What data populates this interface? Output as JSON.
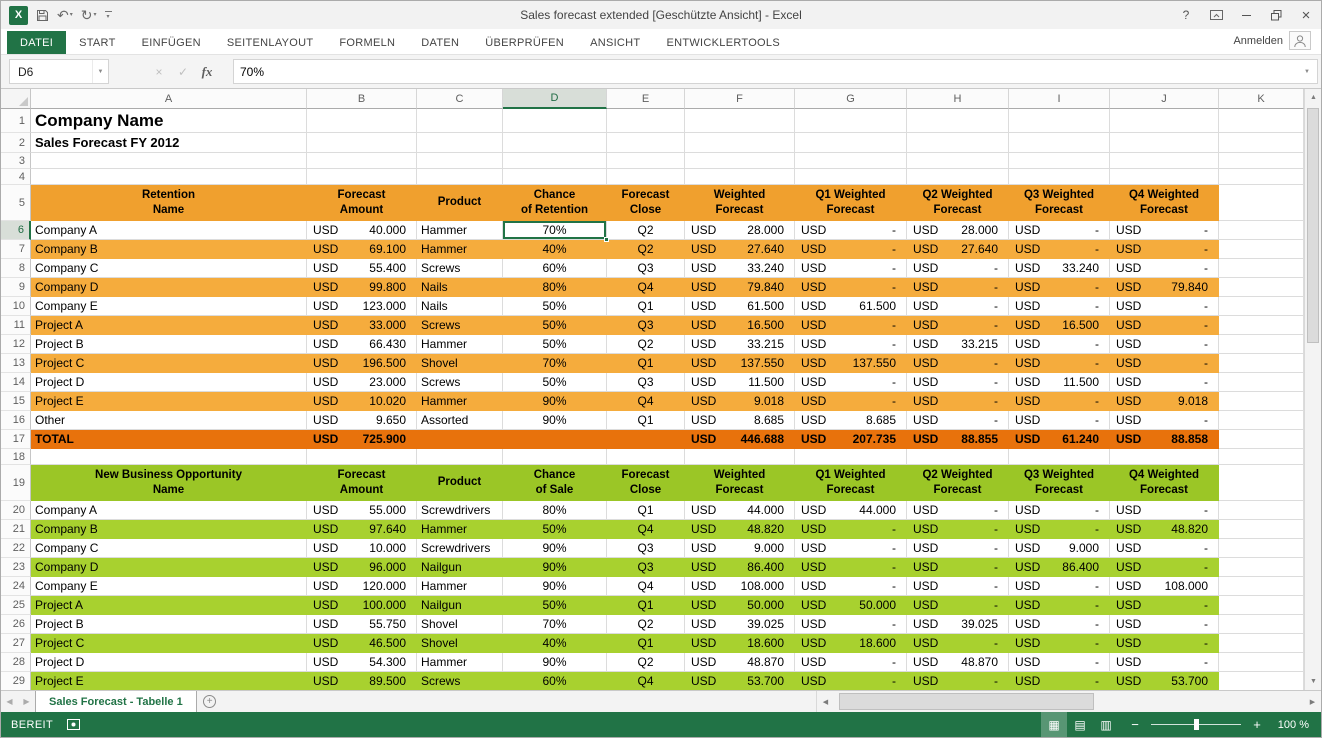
{
  "titlebar": {
    "title": "Sales forecast extended  [Geschützte Ansicht] - Excel",
    "logo_glyph": "X",
    "help_glyph": "?"
  },
  "ribbon": {
    "tabs": [
      {
        "label": "DATEI",
        "active": true
      },
      {
        "label": "START"
      },
      {
        "label": "EINFÜGEN"
      },
      {
        "label": "SEITENLAYOUT"
      },
      {
        "label": "FORMELN"
      },
      {
        "label": "DATEN"
      },
      {
        "label": "ÜBERPRÜFEN"
      },
      {
        "label": "ANSICHT"
      },
      {
        "label": "ENTWICKLERTOOLS"
      }
    ],
    "account_label": "Anmelden"
  },
  "formula_bar": {
    "name_box": "D6",
    "cancel_glyph": "×",
    "enter_glyph": "✓",
    "fx_glyph": "fx",
    "value": "70%"
  },
  "grid": {
    "columns": [
      "A",
      "B",
      "C",
      "D",
      "E",
      "F",
      "G",
      "H",
      "I",
      "J",
      "K"
    ],
    "selected": {
      "cell": "D6",
      "column": "D",
      "row": 6
    },
    "currency": "USD",
    "title": "Company Name",
    "subtitle": "Sales Forecast FY 2012",
    "tables": [
      {
        "accent": "orange",
        "header_row": 5,
        "headers": [
          "Retention\nName",
          "Forecast\nAmount",
          "Product",
          "Chance\nof Retention",
          "Forecast\nClose",
          "Weighted\nForecast",
          "Q1 Weighted\nForecast",
          "Q2 Weighted\nForecast",
          "Q3 Weighted\nForecast",
          "Q4 Weighted\nForecast"
        ],
        "rows": [
          {
            "row": 6,
            "name": "Company A",
            "amount": "40.000",
            "product": "Hammer",
            "chance": "70%",
            "close": "Q2",
            "weighted": "28.000",
            "q1": "-",
            "q2": "28.000",
            "q3": "-",
            "q4": "-",
            "striped": false
          },
          {
            "row": 7,
            "name": "Company B",
            "amount": "69.100",
            "product": "Hammer",
            "chance": "40%",
            "close": "Q2",
            "weighted": "27.640",
            "q1": "-",
            "q2": "27.640",
            "q3": "-",
            "q4": "-",
            "striped": true
          },
          {
            "row": 8,
            "name": "Company C",
            "amount": "55.400",
            "product": "Screws",
            "chance": "60%",
            "close": "Q3",
            "weighted": "33.240",
            "q1": "-",
            "q2": "-",
            "q3": "33.240",
            "q4": "-",
            "striped": false
          },
          {
            "row": 9,
            "name": "Company D",
            "amount": "99.800",
            "product": "Nails",
            "chance": "80%",
            "close": "Q4",
            "weighted": "79.840",
            "q1": "-",
            "q2": "-",
            "q3": "-",
            "q4": "79.840",
            "striped": true
          },
          {
            "row": 10,
            "name": "Company E",
            "amount": "123.000",
            "product": "Nails",
            "chance": "50%",
            "close": "Q1",
            "weighted": "61.500",
            "q1": "61.500",
            "q2": "-",
            "q3": "-",
            "q4": "-",
            "striped": false
          },
          {
            "row": 11,
            "name": "Project A",
            "amount": "33.000",
            "product": "Screws",
            "chance": "50%",
            "close": "Q3",
            "weighted": "16.500",
            "q1": "-",
            "q2": "-",
            "q3": "16.500",
            "q4": "-",
            "striped": true
          },
          {
            "row": 12,
            "name": "Project B",
            "amount": "66.430",
            "product": "Hammer",
            "chance": "50%",
            "close": "Q2",
            "weighted": "33.215",
            "q1": "-",
            "q2": "33.215",
            "q3": "-",
            "q4": "-",
            "striped": false
          },
          {
            "row": 13,
            "name": "Project C",
            "amount": "196.500",
            "product": "Shovel",
            "chance": "70%",
            "close": "Q1",
            "weighted": "137.550",
            "q1": "137.550",
            "q2": "-",
            "q3": "-",
            "q4": "-",
            "striped": true
          },
          {
            "row": 14,
            "name": "Project D",
            "amount": "23.000",
            "product": "Screws",
            "chance": "50%",
            "close": "Q3",
            "weighted": "11.500",
            "q1": "-",
            "q2": "-",
            "q3": "11.500",
            "q4": "-",
            "striped": false
          },
          {
            "row": 15,
            "name": "Project E",
            "amount": "10.020",
            "product": "Hammer",
            "chance": "90%",
            "close": "Q4",
            "weighted": "9.018",
            "q1": "-",
            "q2": "-",
            "q3": "-",
            "q4": "9.018",
            "striped": true
          },
          {
            "row": 16,
            "name": "Other",
            "amount": "9.650",
            "product": "Assorted",
            "chance": "90%",
            "close": "Q1",
            "weighted": "8.685",
            "q1": "8.685",
            "q2": "-",
            "q3": "-",
            "q4": "-",
            "striped": false
          }
        ],
        "total": {
          "row": 17,
          "label": "TOTAL",
          "amount": "725.900",
          "weighted": "446.688",
          "q1": "207.735",
          "q2": "88.855",
          "q3": "61.240",
          "q4": "88.858"
        },
        "empty_row_after": 18
      },
      {
        "accent": "green",
        "header_row": 19,
        "headers": [
          "New Business Opportunity\nName",
          "Forecast\nAmount",
          "Product",
          "Chance\nof Sale",
          "Forecast\nClose",
          "Weighted\nForecast",
          "Q1 Weighted\nForecast",
          "Q2 Weighted\nForecast",
          "Q3 Weighted\nForecast",
          "Q4 Weighted\nForecast"
        ],
        "rows": [
          {
            "row": 20,
            "name": "Company A",
            "amount": "55.000",
            "product": "Screwdrivers",
            "chance": "80%",
            "close": "Q1",
            "weighted": "44.000",
            "q1": "44.000",
            "q2": "-",
            "q3": "-",
            "q4": "-",
            "striped": false
          },
          {
            "row": 21,
            "name": "Company B",
            "amount": "97.640",
            "product": "Hammer",
            "chance": "50%",
            "close": "Q4",
            "weighted": "48.820",
            "q1": "-",
            "q2": "-",
            "q3": "-",
            "q4": "48.820",
            "striped": true
          },
          {
            "row": 22,
            "name": "Company C",
            "amount": "10.000",
            "product": "Screwdrivers",
            "chance": "90%",
            "close": "Q3",
            "weighted": "9.000",
            "q1": "-",
            "q2": "-",
            "q3": "9.000",
            "q4": "-",
            "striped": false
          },
          {
            "row": 23,
            "name": "Company D",
            "amount": "96.000",
            "product": "Nailgun",
            "chance": "90%",
            "close": "Q3",
            "weighted": "86.400",
            "q1": "-",
            "q2": "-",
            "q3": "86.400",
            "q4": "-",
            "striped": true
          },
          {
            "row": 24,
            "name": "Company E",
            "amount": "120.000",
            "product": "Hammer",
            "chance": "90%",
            "close": "Q4",
            "weighted": "108.000",
            "q1": "-",
            "q2": "-",
            "q3": "-",
            "q4": "108.000",
            "striped": false
          },
          {
            "row": 25,
            "name": "Project A",
            "amount": "100.000",
            "product": "Nailgun",
            "chance": "50%",
            "close": "Q1",
            "weighted": "50.000",
            "q1": "50.000",
            "q2": "-",
            "q3": "-",
            "q4": "-",
            "striped": true
          },
          {
            "row": 26,
            "name": "Project B",
            "amount": "55.750",
            "product": "Shovel",
            "chance": "70%",
            "close": "Q2",
            "weighted": "39.025",
            "q1": "-",
            "q2": "39.025",
            "q3": "-",
            "q4": "-",
            "striped": false
          },
          {
            "row": 27,
            "name": "Project C",
            "amount": "46.500",
            "product": "Shovel",
            "chance": "40%",
            "close": "Q1",
            "weighted": "18.600",
            "q1": "18.600",
            "q2": "-",
            "q3": "-",
            "q4": "-",
            "striped": true
          },
          {
            "row": 28,
            "name": "Project D",
            "amount": "54.300",
            "product": "Hammer",
            "chance": "90%",
            "close": "Q2",
            "weighted": "48.870",
            "q1": "-",
            "q2": "48.870",
            "q3": "-",
            "q4": "-",
            "striped": false
          },
          {
            "row": 29,
            "name": "Project E",
            "amount": "89.500",
            "product": "Screws",
            "chance": "60%",
            "close": "Q4",
            "weighted": "53.700",
            "q1": "-",
            "q2": "-",
            "q3": "-",
            "q4": "53.700",
            "striped": true
          }
        ]
      }
    ]
  },
  "sheet_tabs": {
    "tabs": [
      {
        "label": "Sales Forecast - Tabelle 1",
        "active": true
      }
    ],
    "add_glyph": "+"
  },
  "status_bar": {
    "mode": "BEREIT",
    "zoom_out_glyph": "−",
    "zoom_in_glyph": "+",
    "zoom_label": "100 %"
  },
  "colors": {
    "excel_green": "#217346",
    "orange_header": "#F0A02E",
    "orange_stripe": "#F5AC3D",
    "orange_total": "#E8720C",
    "green_header": "#9BC626",
    "green_stripe": "#A8D12F"
  }
}
